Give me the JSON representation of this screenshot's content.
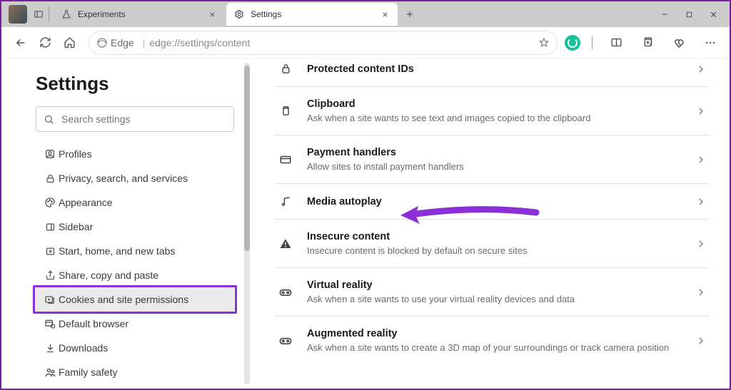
{
  "tabs": [
    {
      "label": "Experiments"
    },
    {
      "label": "Settings"
    }
  ],
  "addr": {
    "edge": "Edge",
    "url": "edge://settings/content"
  },
  "sidebar": {
    "title": "Settings",
    "search_placeholder": "Search settings",
    "items": [
      {
        "label": "Profiles"
      },
      {
        "label": "Privacy, search, and services"
      },
      {
        "label": "Appearance"
      },
      {
        "label": "Sidebar"
      },
      {
        "label": "Start, home, and new tabs"
      },
      {
        "label": "Share, copy and paste"
      },
      {
        "label": "Cookies and site permissions"
      },
      {
        "label": "Default browser"
      },
      {
        "label": "Downloads"
      },
      {
        "label": "Family safety"
      }
    ]
  },
  "rows": [
    {
      "title": "Protected content IDs",
      "sub": ""
    },
    {
      "title": "Clipboard",
      "sub": "Ask when a site wants to see text and images copied to the clipboard"
    },
    {
      "title": "Payment handlers",
      "sub": "Allow sites to install payment handlers"
    },
    {
      "title": "Media autoplay",
      "sub": ""
    },
    {
      "title": "Insecure content",
      "sub": "Insecure content is blocked by default on secure sites"
    },
    {
      "title": "Virtual reality",
      "sub": "Ask when a site wants to use your virtual reality devices and data"
    },
    {
      "title": "Augmented reality",
      "sub": "Ask when a site wants to create a 3D map of your surroundings or track camera position"
    }
  ]
}
